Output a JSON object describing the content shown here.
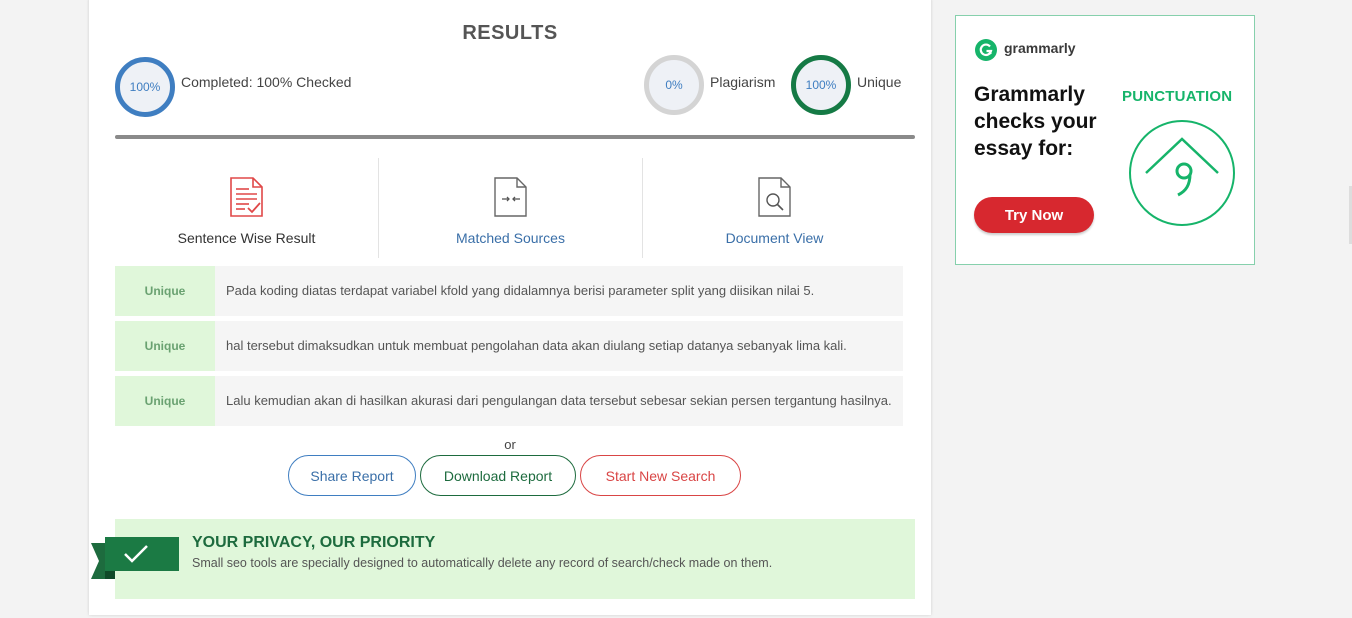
{
  "results": {
    "title": "RESULTS",
    "completed_value": "100%",
    "completed_label": "Completed: 100% Checked",
    "plagiarism_value": "0%",
    "plagiarism_label": "Plagiarism",
    "unique_value": "100%",
    "unique_label": "Unique",
    "progress": 1.0
  },
  "tabs": [
    {
      "label": "Sentence Wise Result",
      "icon": "sentence-result-icon",
      "color": "#333333"
    },
    {
      "label": "Matched Sources",
      "icon": "matched-sources-icon",
      "color": "#3a6fa8"
    },
    {
      "label": "Document View",
      "icon": "document-view-icon",
      "color": "#3a6fa8"
    }
  ],
  "rows": [
    {
      "badge": "Unique",
      "text": "Pada koding diatas terdapat variabel kfold yang didalamnya berisi parameter split yang diisikan nilai 5."
    },
    {
      "badge": "Unique",
      "text": "hal tersebut dimaksudkan untuk membuat pengolahan data akan diulang setiap datanya sebanyak lima kali."
    },
    {
      "badge": "Unique",
      "text": "Lalu kemudian akan di hasilkan akurasi dari pengulangan data tersebut sebesar sekian persen tergantung hasilnya."
    }
  ],
  "actions": {
    "or": "or",
    "share": "Share Report",
    "download": "Download Report",
    "new_search": "Start New Search"
  },
  "privacy": {
    "title": "YOUR PRIVACY, OUR PRIORITY",
    "text": "Small seo tools are specially designed to automatically delete any record of search/check made on them."
  },
  "ad": {
    "brand": "grammarly",
    "headline": "Grammarly checks your essay for:",
    "tag": "PUNCTUATION",
    "cta": "Try Now"
  },
  "colors": {
    "blue": "#3f7ec1",
    "green": "#157a45",
    "red": "#d94545",
    "unique_bg": "#e0f7da",
    "grammarly_green": "#16b46a"
  }
}
